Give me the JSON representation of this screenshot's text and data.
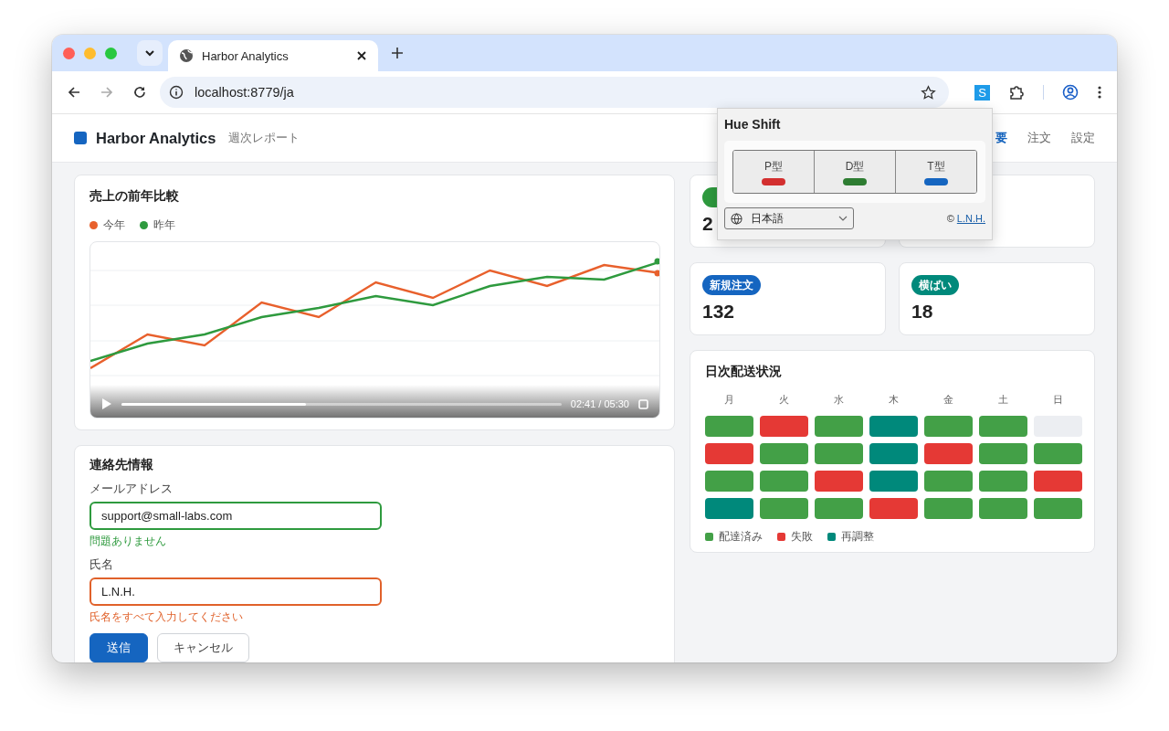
{
  "browser": {
    "tab_title": "Harbor Analytics",
    "url": "localhost:8779/ja",
    "extension_label": "S"
  },
  "header": {
    "brand": "Harbor Analytics",
    "subtitle": "週次レポート",
    "nav": [
      {
        "label": "要",
        "selected": true
      },
      {
        "label": "注文",
        "selected": false
      },
      {
        "label": "設定",
        "selected": false
      }
    ]
  },
  "sales_card": {
    "title": "売上の前年比較",
    "series": [
      {
        "name": "今年",
        "color": "#e8602c"
      },
      {
        "name": "昨年",
        "color": "#2e9a3e"
      }
    ],
    "video": {
      "time": "02:41 / 05:30",
      "level": 0.42
    }
  },
  "contact_form": {
    "title": "連絡先情報",
    "fields": [
      {
        "label": "メールアドレス",
        "value": "support@small-labs.com",
        "kind": "valid",
        "message": "問題ありません"
      },
      {
        "label": "氏名",
        "value": "L.N.H.",
        "kind": "error",
        "message": "氏名をすべて入力してください"
      }
    ],
    "buttons": [
      {
        "label": "送信",
        "kind": "primary"
      },
      {
        "label": "キャンセル",
        "kind": "secondary"
      }
    ]
  },
  "kpis": [
    {
      "color": "#2e9a3e",
      "value": "2"
    },
    {
      "badge": "新規注文",
      "color": "#1565c0",
      "value": "132"
    },
    {
      "badge": "横ばい",
      "color": "#00897b",
      "value": "18"
    }
  ],
  "delivery": {
    "title": "日次配送状況",
    "days": [
      "月",
      "火",
      "水",
      "木",
      "金",
      "土",
      "日"
    ],
    "rows": [
      [
        {
          "color": "#43a047"
        },
        {
          "color": "#e53935"
        },
        {
          "color": "#43a047"
        },
        {
          "color": "#00897b"
        },
        {
          "color": "#43a047"
        },
        {
          "color": "#43a047"
        },
        {
          "color": "#eceef2"
        }
      ],
      [
        {
          "color": "#e53935"
        },
        {
          "color": "#43a047"
        },
        {
          "color": "#43a047"
        },
        {
          "color": "#00897b"
        },
        {
          "color": "#e53935"
        },
        {
          "color": "#43a047"
        },
        {
          "color": "#43a047"
        }
      ],
      [
        {
          "color": "#43a047"
        },
        {
          "color": "#43a047"
        },
        {
          "color": "#e53935"
        },
        {
          "color": "#00897b"
        },
        {
          "color": "#43a047"
        },
        {
          "color": "#43a047"
        },
        {
          "color": "#e53935"
        }
      ],
      [
        {
          "color": "#00897b"
        },
        {
          "color": "#43a047"
        },
        {
          "color": "#43a047"
        },
        {
          "color": "#e53935"
        },
        {
          "color": "#43a047"
        },
        {
          "color": "#43a047"
        },
        {
          "color": "#43a047"
        }
      ]
    ],
    "legend": [
      {
        "label": "配達済み",
        "color": "#43a047"
      },
      {
        "label": "失敗",
        "color": "#e53935"
      },
      {
        "label": "再調整",
        "color": "#00897b"
      }
    ]
  },
  "popup": {
    "title": "Hue Shift",
    "modes": [
      {
        "label": "P型",
        "color": "#d32f2f"
      },
      {
        "label": "D型",
        "color": "#2e7d32"
      },
      {
        "label": "T型",
        "color": "#1565c0"
      }
    ],
    "language": "日本語",
    "copyright": "©",
    "author_link": "L.N.H."
  }
}
